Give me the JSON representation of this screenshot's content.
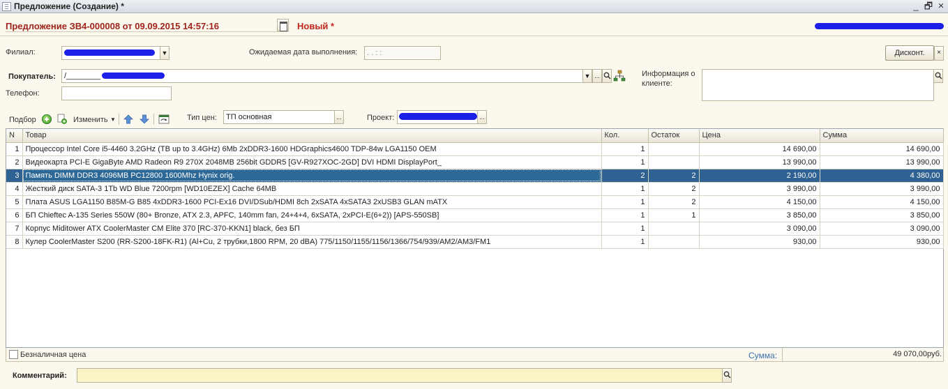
{
  "window": {
    "title": "Предложение (Создание) *",
    "minimize_glyph": "_",
    "restore_glyph": "🗗",
    "close_glyph": "×"
  },
  "header": {
    "doc_title": "Предложение ЗВ4-000008 от 09.09.2015 14:57:16",
    "status": "Новый *"
  },
  "form": {
    "branch_label": "Филиал:",
    "expected_date_label": "Ожидаемая дата выполнения:",
    "expected_date_value": "  .  .      :  :",
    "discount_button": "Дисконт.",
    "buyer_label": "Покупатель:",
    "buyer_value": "/________",
    "client_info_label_1": "Информация о",
    "client_info_label_2": "клиенте:",
    "phone_label": "Телефон:",
    "phone_value": "",
    "price_type_label": "Тип цен:",
    "price_type_value": "ТП основная",
    "project_label": "Проект:",
    "ellipsis": "..."
  },
  "toolbar": {
    "pick_label": "Подбор",
    "edit_label": "Изменить"
  },
  "table": {
    "columns": [
      "N",
      "Товар",
      "Кол.",
      "Остаток",
      "Цена",
      "Сумма"
    ],
    "rows": [
      {
        "n": "1",
        "name": "Процессор Intel Core i5-4460 3.2GHz (TB up to 3.4GHz)  6Mb 2xDDR3-1600 HDGraphics4600 TDP-84w  LGA1150  OEM",
        "qty": "1",
        "stock": "",
        "price": "14 690,00",
        "sum": "14 690,00"
      },
      {
        "n": "2",
        "name": "Видеокарта PCI-E GigaByte AMD Radeon R9 270X 2048MB 256bit GDDR5 [GV-R927XOC-2GD] DVI HDMI DisplayPort_",
        "qty": "1",
        "stock": "",
        "price": "13 990,00",
        "sum": "13 990,00"
      },
      {
        "n": "3",
        "name": "Память DIMM DDR3 4096MB PC12800 1600Mhz Hynix orig.",
        "qty": "2",
        "stock": "2",
        "price": "2 190,00",
        "sum": "4 380,00"
      },
      {
        "n": "4",
        "name": "Жесткий диск SATA-3  1Tb WD Blue 7200rpm [WD10EZEX] Cache 64MB",
        "qty": "1",
        "stock": "2",
        "price": "3 990,00",
        "sum": "3 990,00"
      },
      {
        "n": "5",
        "name": "Плата ASUS LGA1150 B85M-G B85 4xDDR3-1600 PCI-Ex16 DVI/DSub/HDMI 8ch 2xSATA 4xSATA3 2xUSB3 GLAN mATX",
        "qty": "1",
        "stock": "2",
        "price": "4 150,00",
        "sum": "4 150,00"
      },
      {
        "n": "6",
        "name": "БП Chieftec A-135 Series 550W (80+ Bronze, ATX 2.3, APFC, 140mm fan, 24+4+4, 6xSATA, 2xPCI-E(6+2)) [APS-550SB]",
        "qty": "1",
        "stock": "1",
        "price": "3 850,00",
        "sum": "3 850,00"
      },
      {
        "n": "7",
        "name": "Корпус Miditower ATX CoolerMaster CM Elite 370 [RC-370-KKN1] black, без БП",
        "qty": "1",
        "stock": "",
        "price": "3 090,00",
        "sum": "3 090,00"
      },
      {
        "n": "8",
        "name": "Кулер CoolerMaster S200 (RR-S200-18FK-R1) (Al+Cu, 2 трубки,1800 RPM, 20 dBA) 775/1150/1155/1156/1366/754/939/AM2/AM3/FM1",
        "qty": "1",
        "stock": "",
        "price": "930,00",
        "sum": "930,00"
      }
    ],
    "selected_row": 2
  },
  "footer": {
    "cashless_label": "Безналичная цена",
    "sum_label": "Сумма:",
    "sum_value": "49 070,00руб.",
    "comment_label": "Комментарий:"
  },
  "colors": {
    "doc_title": "#a0241b",
    "selected_row": "#2f6193",
    "redaction": "#1a20e6",
    "comment_bg": "#fbf4c6"
  }
}
